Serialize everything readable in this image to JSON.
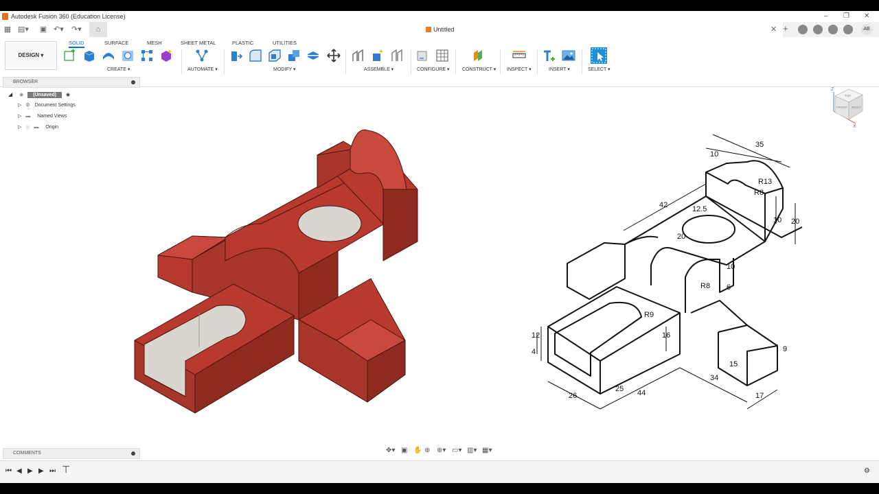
{
  "window": {
    "title": "Autodesk Fusion 360 (Education License)"
  },
  "document": {
    "tab_title": "Untitled"
  },
  "user": {
    "initials": "AB"
  },
  "workspace": {
    "label": "DESIGN ▾"
  },
  "ribbon": {
    "tabs": [
      "SOLID",
      "SURFACE",
      "MESH",
      "SHEET METAL",
      "PLASTIC",
      "UTILITIES"
    ],
    "groups": [
      "CREATE ▾",
      "AUTOMATE ▾",
      "MODIFY ▾",
      "ASSEMBLE ▾",
      "CONFIGURE ▾",
      "CONSTRUCT ▾",
      "INSPECT ▾",
      "INSERT ▾",
      "SELECT ▾"
    ]
  },
  "browser": {
    "title": "BROWSER",
    "root": "(Unsaved)",
    "items": [
      "Document Settings",
      "Named Views",
      "Origin"
    ]
  },
  "comments": {
    "title": "COMMENTS"
  },
  "viewcube": {
    "top": "TOP",
    "front": "FRONT",
    "right": "RIGHT",
    "z": "Z",
    "x": "X"
  },
  "drawing": {
    "dimensions": [
      "35",
      "10",
      "R13",
      "R8",
      "42",
      "12.5",
      "20",
      "10",
      "20",
      "10",
      "R8",
      "6",
      "R9",
      "16",
      "12",
      "4",
      "26",
      "25",
      "44",
      "34",
      "15",
      "9",
      "17"
    ]
  },
  "colors": {
    "accent": "#0a6ebd",
    "model": "#b83a2e",
    "model_shade": "#8e2a20",
    "bore": "#d9d6cf"
  }
}
